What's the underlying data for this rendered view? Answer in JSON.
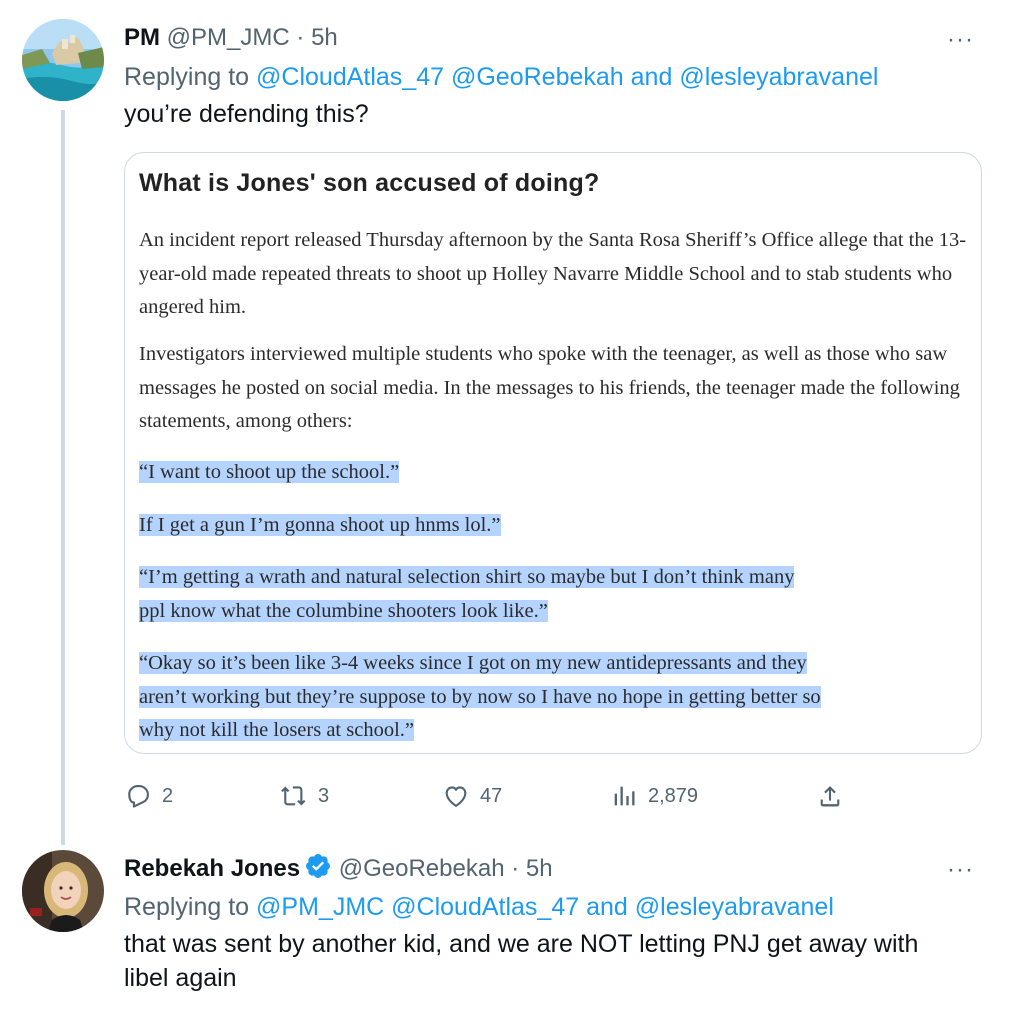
{
  "tweet1": {
    "name": "PM",
    "handle": "@PM_JMC",
    "separator": "·",
    "time": "5h",
    "more": "···",
    "replying_prefix": "Replying to",
    "mention1": "@CloudAtlas_47",
    "mention2": "@GeoRebekah",
    "and_word": "and",
    "mention3": "@lesleyabravanel",
    "text": "you’re defending this?",
    "embed": {
      "heading": "What is Jones' son accused of doing?",
      "para1": "An incident report released Thursday afternoon by the Santa Rosa Sheriff’s Office allege that the 13-year-old made repeated threats to shoot up Holley Navarre Middle School and to stab students who angered him.",
      "para2": "Investigators interviewed multiple students who spoke with the teenager, as well as those who saw messages he posted on social media. In the messages to his friends, the teenager made the following statements, among others:",
      "quote1": "“I want to shoot up the school.”",
      "quote2": "If I get a gun I’m gonna shoot up hnms lol.”",
      "quote3_line1": "“I’m getting a wrath and natural selection shirt so maybe but I don’t think many",
      "quote3_line2": "ppl know what the columbine shooters look like.”",
      "quote4_line1": "“Okay so it’s been like 3-4 weeks since I got on my new antidepressants and they",
      "quote4_line2": "aren’t working but they’re suppose to by now so I have no hope in getting better so",
      "quote4_line3": "why not kill the losers at school.”"
    },
    "stats": {
      "replies": "2",
      "retweets": "3",
      "likes": "47",
      "views": "2,879"
    }
  },
  "tweet2": {
    "name": "Rebekah Jones",
    "handle": "@GeoRebekah",
    "separator": "·",
    "time": "5h",
    "more": "···",
    "replying_prefix": "Replying to",
    "mention1": "@PM_JMC",
    "mention2": "@CloudAtlas_47",
    "and_word": "and",
    "mention3": "@lesleyabravanel",
    "text_line1": "that was sent by another kid, and we are NOT letting PNJ get away with",
    "text_line2": "libel again"
  },
  "colors": {
    "link": "#1d9bf0",
    "muted": "#536471",
    "highlight": "#b4d4ff",
    "verified": "#1d9bf0"
  }
}
